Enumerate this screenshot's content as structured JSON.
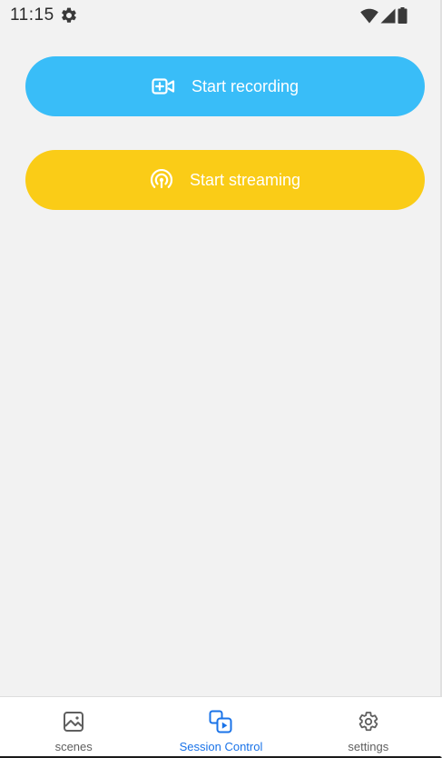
{
  "status_bar": {
    "time": "11:15",
    "icons": [
      "settings-gear-icon",
      "wifi-icon",
      "signal-icon",
      "battery-icon"
    ]
  },
  "actions": {
    "record": {
      "label": "Start recording",
      "icon": "video-add-icon",
      "color": "#39bdf8"
    },
    "stream": {
      "label": "Start streaming",
      "icon": "broadcast-icon",
      "color": "#facc17"
    }
  },
  "nav": {
    "active_color": "#1a73e8",
    "items": [
      {
        "label": "scenes",
        "icon": "image-icon",
        "active": false
      },
      {
        "label": "Session Control",
        "icon": "session-control-icon",
        "active": true
      },
      {
        "label": "settings",
        "icon": "gear-icon",
        "active": false
      }
    ]
  }
}
